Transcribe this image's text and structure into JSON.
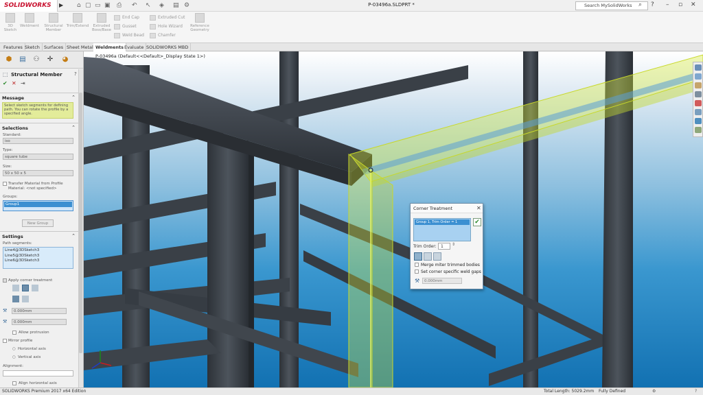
{
  "app": {
    "brand": "SOLIDWORKS",
    "document_title": "P-03496a.SLDPRT *",
    "search_placeholder": "Search MySolidWorks"
  },
  "ribbon": {
    "big_buttons": [
      {
        "label": "3D Sketch"
      },
      {
        "label": "Weldment"
      },
      {
        "label": "Structural Member"
      },
      {
        "label": "Trim/Extend"
      },
      {
        "label": "Extruded Boss/Base"
      }
    ],
    "small_col1": [
      "End Cap",
      "Gusset",
      "Weld Bead"
    ],
    "small_col2": [
      "Extruded Cut",
      "Hole Wizard",
      "Chamfer"
    ],
    "ref_geometry": "Reference Geometry"
  },
  "tabs": [
    "Features",
    "Sketch",
    "Surfaces",
    "Sheet Metal",
    "Weldments",
    "Evaluate",
    "SOLIDWORKS MBD"
  ],
  "active_tab": "Weldments",
  "tree_item": "P-03496a (Default<<Default>_Display State 1>)",
  "panel": {
    "title": "Structural Member",
    "message_header": "Message",
    "message_text": "Select sketch segments for defining path. You can rotate the profile by a specified angle.",
    "selections_header": "Selections",
    "standard_label": "Standard:",
    "standard_value": "iso",
    "type_label": "Type:",
    "type_value": "square tube",
    "size_label": "Size:",
    "size_value": "50 x 50 x 5",
    "transfer_label": "Transfer Material from Profile",
    "material_label": "Material: <not specified>",
    "groups_label": "Groups:",
    "group_selected": "Group1",
    "new_group": "New Group",
    "settings_header": "Settings",
    "path_label": "Path segments:",
    "path_segments": [
      "Line4@3DSketch3",
      "Line5@3DSketch3",
      "Line6@3DSketch3"
    ],
    "apply_corner": "Apply corner treatment",
    "gap1": "0.000mm",
    "gap2": "0.000mm",
    "allow_protrusion": "Allow protrusion",
    "mirror_profile": "Mirror profile",
    "horizontal_axis": "Horizontal axis",
    "vertical_axis": "Vertical axis",
    "alignment_label": "Alignment:",
    "align_horizontal": "Align horizontal axis"
  },
  "corner_dialog": {
    "title": "Corner Treatment",
    "list_item": "Group 1, Trim Order = 1",
    "trim_order_label": "Trim Order:",
    "trim_order_value": "1",
    "merge_label": "Merge miter trimmed bodies",
    "gap_label": "Set corner specific weld gaps",
    "gap_value": "0.000mm"
  },
  "status": {
    "edition": "SOLIDWORKS Premium 2017 x64 Edition",
    "total_length": "Total Length: 5029.2mm",
    "state": "Fully Defined"
  },
  "colors": {
    "accent": "#c8102e",
    "selection": "#d9ec3a",
    "sky_top": "#ffffff",
    "sky_bottom": "#1271b2",
    "beam": "#3e444b"
  }
}
